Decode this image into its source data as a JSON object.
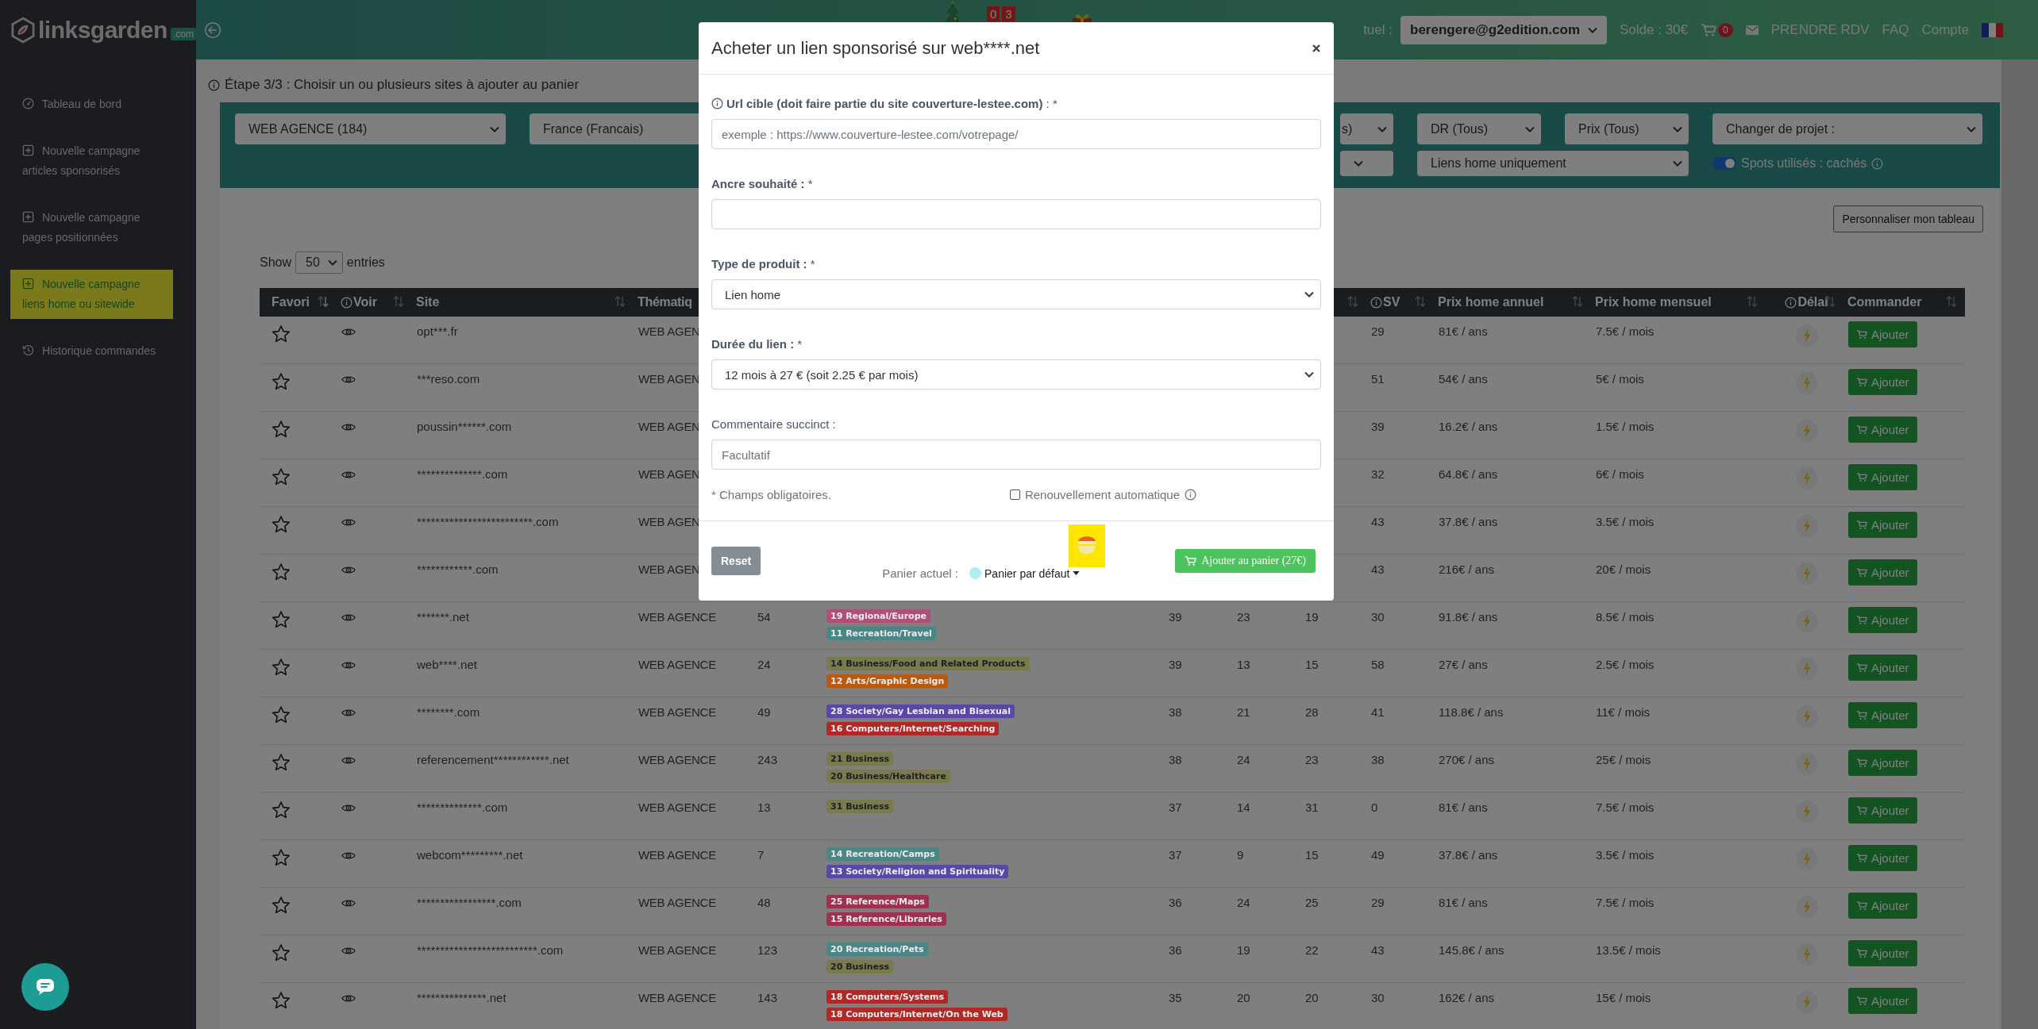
{
  "sidebar": {
    "logo": {
      "name": "linksgarden",
      "badge": ".com"
    },
    "items": [
      {
        "label": "Tableau de bord",
        "selected": false
      },
      {
        "label": "Nouvelle campagne articles sponsorisés",
        "selected": false
      },
      {
        "label": "Nouvelle campagne pages positionnées",
        "selected": false
      },
      {
        "label": "Nouvelle campagne liens home ou sitewide",
        "selected": true
      },
      {
        "label": "Historique commandes",
        "selected": false
      }
    ]
  },
  "topbar": {
    "counter": [
      "0",
      "3"
    ],
    "cart_label": "tuel :",
    "account": "berengere@g2edition.com",
    "balance": "Solde : 30€",
    "cart_count": "0",
    "links": [
      "PRENDRE RDV",
      "FAQ",
      "Compte"
    ]
  },
  "step": "Étape 3/3 : Choisir un ou plusieurs sites à ajouter au panier",
  "filters": [
    [
      {
        "kind": "select",
        "value": "WEB AGENCE (184)"
      },
      {
        "kind": "select",
        "value": "France (Francais)"
      },
      {
        "kind": "select",
        "value": "s)"
      },
      {
        "kind": "select",
        "value": "DR (Tous)"
      },
      {
        "kind": "select",
        "value": "Prix (Tous)"
      },
      {
        "kind": "select",
        "value": "Changer de projet :"
      }
    ],
    [
      {
        "kind": "select"
      },
      {
        "kind": "select",
        "value": "Liens home uniquement"
      },
      {
        "kind": "toggle",
        "label": "Spots utilisés : cachés",
        "on": true
      }
    ]
  ],
  "customize_button": "Personnaliser mon tableau",
  "show": {
    "before": "Show",
    "value": "50",
    "after": "entries"
  },
  "columns": [
    {
      "label": "Favori",
      "sort_icon": true
    },
    {
      "label": "Voir",
      "info": true,
      "sort_icon": true
    },
    {
      "label": "Site",
      "sort_icon": true
    },
    {
      "label": "Thématiq"
    },
    {
      "sort_icon": true
    },
    {
      "label": "SV",
      "info": true,
      "sort_icon": true
    },
    {
      "label": "Prix home annuel",
      "sort_icon": true
    },
    {
      "label": "Prix home mensuel",
      "sort_icon": true
    },
    {
      "label": "Délai",
      "info": true,
      "sort_icon": true
    },
    {
      "label": "Commander",
      "sort_icon": true
    }
  ],
  "rows": [
    {
      "favorite": false,
      "site": "opt***.fr",
      "theme": "WEB AGEN",
      "sv": "29",
      "annual": "81€ / ans",
      "monthly": "7.5€ / mois",
      "button": "Ajouter"
    },
    {
      "favorite": false,
      "site": "***reso.com",
      "theme": "WEB AGEN",
      "sv": "51",
      "annual": "54€ / ans",
      "monthly": "5€ / mois",
      "button": "Ajouter"
    },
    {
      "favorite": false,
      "site": "poussin******.com",
      "theme": "WEB AGEN",
      "sv": "39",
      "annual": "16.2€ / ans",
      "monthly": "1.5€ / mois",
      "button": "Ajouter"
    },
    {
      "favorite": false,
      "site": "**************.com",
      "theme": "WEB AGEN",
      "sv": "32",
      "annual": "64.8€ / ans",
      "monthly": "6€ / mois",
      "button": "Ajouter"
    },
    {
      "favorite": false,
      "site": "*************************.com",
      "theme": "WEB AGEN",
      "sv": "43",
      "annual": "37.8€ / ans",
      "monthly": "3.5€ / mois",
      "button": "Ajouter"
    },
    {
      "favorite": false,
      "site": "************.com",
      "theme": "WEB AGEN",
      "sv": "43",
      "annual": "216€ / ans",
      "monthly": "20€ / mois",
      "button": "Ajouter"
    },
    {
      "favorite": false,
      "site": "*******.net",
      "theme": "WEB AGENCE",
      "column_5": "54",
      "column_6": [
        {
          "label": "19 Regional/Europe",
          "color": "#b0507a"
        },
        {
          "label": "11 Recreation/Travel",
          "color": "#4a8686"
        }
      ],
      "column_7": "39",
      "column_8": "23",
      "column_9": "19",
      "sv": "30",
      "annual": "91.8€ / ans",
      "monthly": "8.5€ / mois",
      "button": "Ajouter"
    },
    {
      "favorite": false,
      "site": "web****.net",
      "theme": "WEB AGENCE",
      "column_5": "24",
      "column_6": [
        {
          "label": "14 Business/Food and Related Products",
          "color": "#7a7a50"
        },
        {
          "label": "12 Arts/Graphic Design",
          "color": "#b85a10"
        }
      ],
      "column_7": "39",
      "column_8": "13",
      "column_9": "15",
      "sv": "58",
      "annual": "27€ / ans",
      "monthly": "2.5€ / mois",
      "button": "Ajouter"
    },
    {
      "favorite": false,
      "site": "********.com",
      "theme": "WEB AGENCE",
      "column_5": "49",
      "column_6": [
        {
          "label": "28 Society/Gay Lesbian and Bisexual",
          "color": "#5a48a8"
        },
        {
          "label": "16 Computers/Internet/Searching",
          "color": "#b02828"
        }
      ],
      "column_7": "38",
      "column_8": "21",
      "column_9": "28",
      "sv": "41",
      "annual": "118.8€ / ans",
      "monthly": "11€ / mois",
      "button": "Ajouter"
    },
    {
      "favorite": false,
      "site": "referencement************.net",
      "theme": "WEB AGENCE",
      "column_5": "243",
      "column_6": [
        {
          "label": "21 Business",
          "color": "#7a7a50"
        },
        {
          "label": "20 Business/Healthcare",
          "color": "#7a7a50"
        }
      ],
      "column_7": "38",
      "column_8": "24",
      "column_9": "23",
      "sv": "38",
      "annual": "270€ / ans",
      "monthly": "25€ / mois",
      "button": "Ajouter"
    },
    {
      "favorite": false,
      "site": "**************.com",
      "theme": "WEB AGENCE",
      "column_5": "13",
      "column_6": [
        {
          "label": "31 Business",
          "color": "#7a7a50"
        }
      ],
      "column_7": "37",
      "column_8": "14",
      "column_9": "31",
      "sv": "0",
      "annual": "81€ / ans",
      "monthly": "7.5€ / mois",
      "button": "Ajouter"
    },
    {
      "favorite": false,
      "site": "webcom*********.net",
      "theme": "WEB AGENCE",
      "column_5": "7",
      "column_6": [
        {
          "label": "14 Recreation/Camps",
          "color": "#4a8686"
        },
        {
          "label": "13 Society/Religion and Spirituality",
          "color": "#5a48a8"
        }
      ],
      "column_7": "37",
      "column_8": "9",
      "column_9": "15",
      "sv": "49",
      "annual": "37.8€ / ans",
      "monthly": "3.5€ / mois",
      "button": "Ajouter"
    },
    {
      "favorite": false,
      "site": "*****************.com",
      "theme": "WEB AGENCE",
      "column_5": "48",
      "column_6": [
        {
          "label": "25 Reference/Maps",
          "color": "#a03050"
        },
        {
          "label": "15 Reference/Libraries",
          "color": "#a03050"
        }
      ],
      "column_7": "36",
      "column_8": "24",
      "column_9": "25",
      "sv": "29",
      "annual": "81€ / ans",
      "monthly": "7.5€ / mois",
      "button": "Ajouter"
    },
    {
      "favorite": false,
      "site": "**************************.com",
      "theme": "WEB AGENCE",
      "column_5": "123",
      "column_6": [
        {
          "label": "20 Recreation/Pets",
          "color": "#4a8686"
        },
        {
          "label": "20 Business",
          "color": "#7a7a50"
        }
      ],
      "column_7": "36",
      "column_8": "19",
      "column_9": "22",
      "sv": "43",
      "annual": "145.8€ / ans",
      "monthly": "13.5€ / mois",
      "button": "Ajouter"
    },
    {
      "favorite": false,
      "site": "***************.net",
      "theme": "WEB AGENCE",
      "column_5": "143",
      "column_6": [
        {
          "label": "18 Computers/Systems",
          "color": "#b02828"
        },
        {
          "label": "18 Computers/Internet/On the Web",
          "color": "#b02828"
        }
      ],
      "column_7": "35",
      "column_8": "20",
      "column_9": "20",
      "sv": "30",
      "annual": "162€ / ans",
      "monthly": "15€ / mois",
      "button": "Ajouter"
    }
  ],
  "modal": {
    "title": "Acheter un lien sponsorisé sur web****.net",
    "fields": [
      {
        "kind": "input",
        "info": true,
        "label": "**Url cible (doit faire partie du site couverture-lestee.com)** : *",
        "placeholder": "exemple : https://www.couverture-lestee.com/votrepage/"
      },
      {
        "kind": "input",
        "label": "**Ancre souhaité :** *"
      },
      {
        "kind": "select",
        "label": "**Type de produit :** *",
        "value": "Lien home"
      },
      {
        "kind": "select",
        "label": "**Durée du lien :** *",
        "value": "12 mois à 27 € (soit 2.25 € par mois)"
      },
      {
        "kind": "input",
        "label": "Commentaire succinct :",
        "placeholder": "Facultatif"
      }
    ],
    "required_note": "* Champs obligatoires.",
    "auto_renew": {
      "label": "Renouvellement automatique",
      "checked": false
    },
    "reset": "Reset",
    "cart_label": "Panier actuel :",
    "cart": "Panier par défaut",
    "submit": "Ajouter au panier (27€)"
  }
}
